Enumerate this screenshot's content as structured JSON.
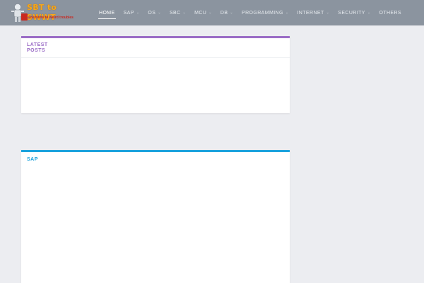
{
  "logo": {
    "brand_text": "SBT to SWWT",
    "tagline": "solutions to weird troubles"
  },
  "nav": {
    "items": [
      {
        "label": "HOME",
        "active": true,
        "has_dropdown": false
      },
      {
        "label": "SAP",
        "active": false,
        "has_dropdown": true
      },
      {
        "label": "OS",
        "active": false,
        "has_dropdown": true
      },
      {
        "label": "SBC",
        "active": false,
        "has_dropdown": true
      },
      {
        "label": "MCU",
        "active": false,
        "has_dropdown": true
      },
      {
        "label": "DB",
        "active": false,
        "has_dropdown": true
      },
      {
        "label": "PROGRAMMING",
        "active": false,
        "has_dropdown": true
      },
      {
        "label": "INTERNET",
        "active": false,
        "has_dropdown": true
      },
      {
        "label": "SECURITY",
        "active": false,
        "has_dropdown": true
      },
      {
        "label": "OTHERS",
        "active": false,
        "has_dropdown": false
      }
    ],
    "dropdown_icon": "chevron-down-icon"
  },
  "sections": {
    "latest_posts": {
      "title": "LATEST POSTS",
      "accent": "#9a6cc6"
    },
    "sap": {
      "title": "SAP",
      "accent": "#1da3dd"
    }
  },
  "colors": {
    "header_bg": "#8b949f",
    "page_bg": "#ecedf1",
    "logo_orange": "#f7a81a",
    "logo_red": "#c9271f"
  }
}
